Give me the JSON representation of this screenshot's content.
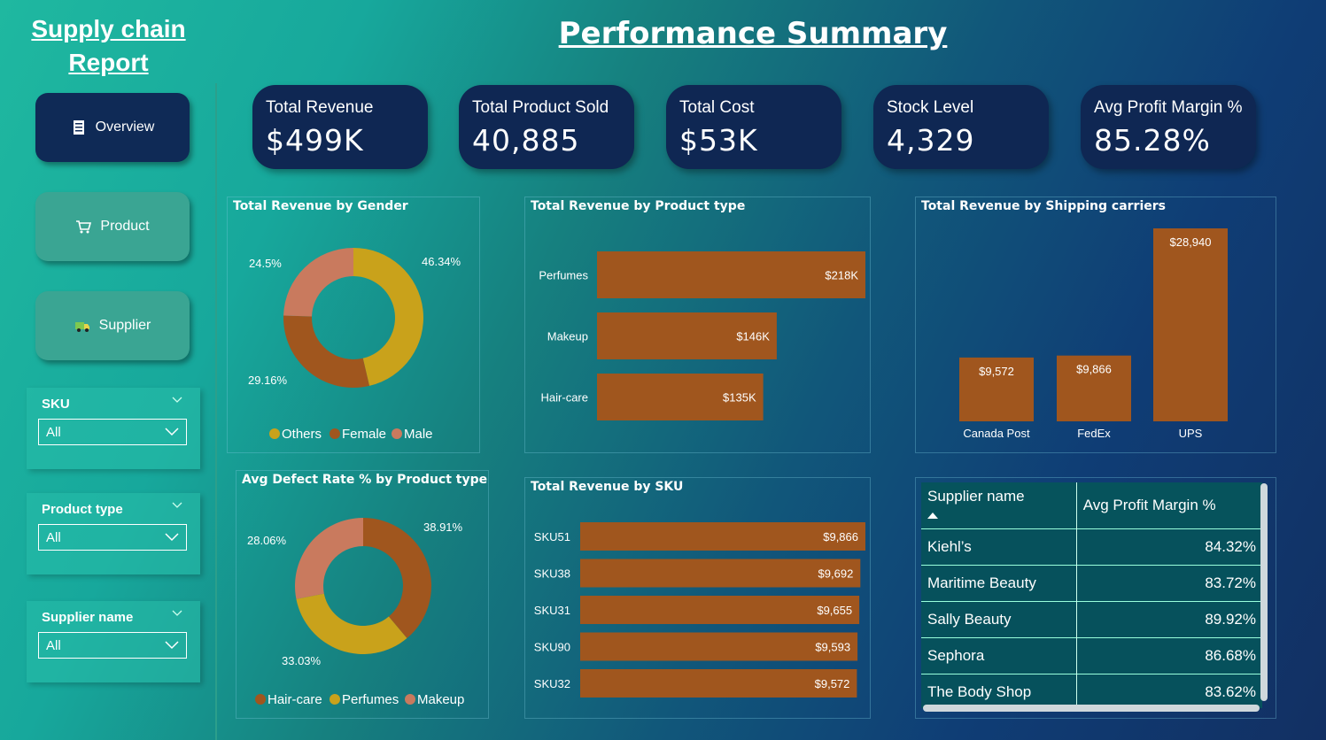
{
  "report_title_line1": "Supply chain",
  "report_title_line2": "Report",
  "page_title": "Performance Summary",
  "nav": {
    "overview": "Overview",
    "product": "Product",
    "supplier": "Supplier"
  },
  "slicers": {
    "sku": {
      "label": "SKU",
      "value": "All"
    },
    "product_type": {
      "label": "Product type",
      "value": "All"
    },
    "supplier_name": {
      "label": "Supplier name",
      "value": "All"
    }
  },
  "kpis": {
    "revenue": {
      "label": "Total Revenue",
      "value": "$499K"
    },
    "sold": {
      "label": "Total Product Sold",
      "value": "40,885"
    },
    "cost": {
      "label": "Total Cost",
      "value": "$53K"
    },
    "stock": {
      "label": "Stock Level",
      "value": "4,329"
    },
    "margin": {
      "label": "Avg Profit Margin %",
      "value": "85.28%"
    }
  },
  "colors": {
    "bar": "#a0561e",
    "gold": "#c9a21b",
    "brown": "#a0561e",
    "salmon": "#c97a5e"
  },
  "chart_data": [
    {
      "id": "gender",
      "type": "pie",
      "title": "Total Revenue by Gender",
      "categories": [
        "Others",
        "Female",
        "Male"
      ],
      "values": [
        46.34,
        29.16,
        24.5
      ],
      "labels": [
        "46.34%",
        "29.16%",
        "24.5%"
      ],
      "legend": "bottom"
    },
    {
      "id": "product_type",
      "type": "bar",
      "orientation": "horizontal",
      "title": "Total Revenue by Product type",
      "categories": [
        "Perfumes",
        "Makeup",
        "Hair-care"
      ],
      "values": [
        218,
        146,
        135
      ],
      "labels": [
        "$218K",
        "$146K",
        "$135K"
      ],
      "unit": "$K"
    },
    {
      "id": "carriers",
      "type": "bar",
      "orientation": "vertical",
      "title": "Total Revenue by Shipping carriers",
      "categories": [
        "Canada Post",
        "FedEx",
        "UPS"
      ],
      "values": [
        9572,
        9866,
        28940
      ],
      "labels": [
        "$9,572",
        "$9,866",
        "$28,940"
      ]
    },
    {
      "id": "defect",
      "type": "pie",
      "title": "Avg Defect Rate % by Product type",
      "categories": [
        "Hair-care",
        "Perfumes",
        "Makeup"
      ],
      "values": [
        38.91,
        33.03,
        28.06
      ],
      "labels": [
        "38.91%",
        "33.03%",
        "28.06%"
      ],
      "legend": "bottom"
    },
    {
      "id": "sku",
      "type": "bar",
      "orientation": "horizontal",
      "title": "Total Revenue by SKU",
      "categories": [
        "SKU51",
        "SKU38",
        "SKU31",
        "SKU90",
        "SKU32"
      ],
      "values": [
        9866,
        9692,
        9655,
        9593,
        9572
      ],
      "labels": [
        "$9,866",
        "$9,692",
        "$9,655",
        "$9,593",
        "$9,572"
      ]
    },
    {
      "id": "supplier_table",
      "type": "table",
      "columns": [
        "Supplier name",
        "Avg Profit Margin %"
      ],
      "rows": [
        [
          "Kiehl’s",
          "84.32%"
        ],
        [
          "Maritime Beauty",
          "83.72%"
        ],
        [
          "Sally Beauty",
          "89.92%"
        ],
        [
          "Sephora",
          "86.68%"
        ],
        [
          "The Body Shop",
          "83.62%"
        ]
      ]
    }
  ]
}
